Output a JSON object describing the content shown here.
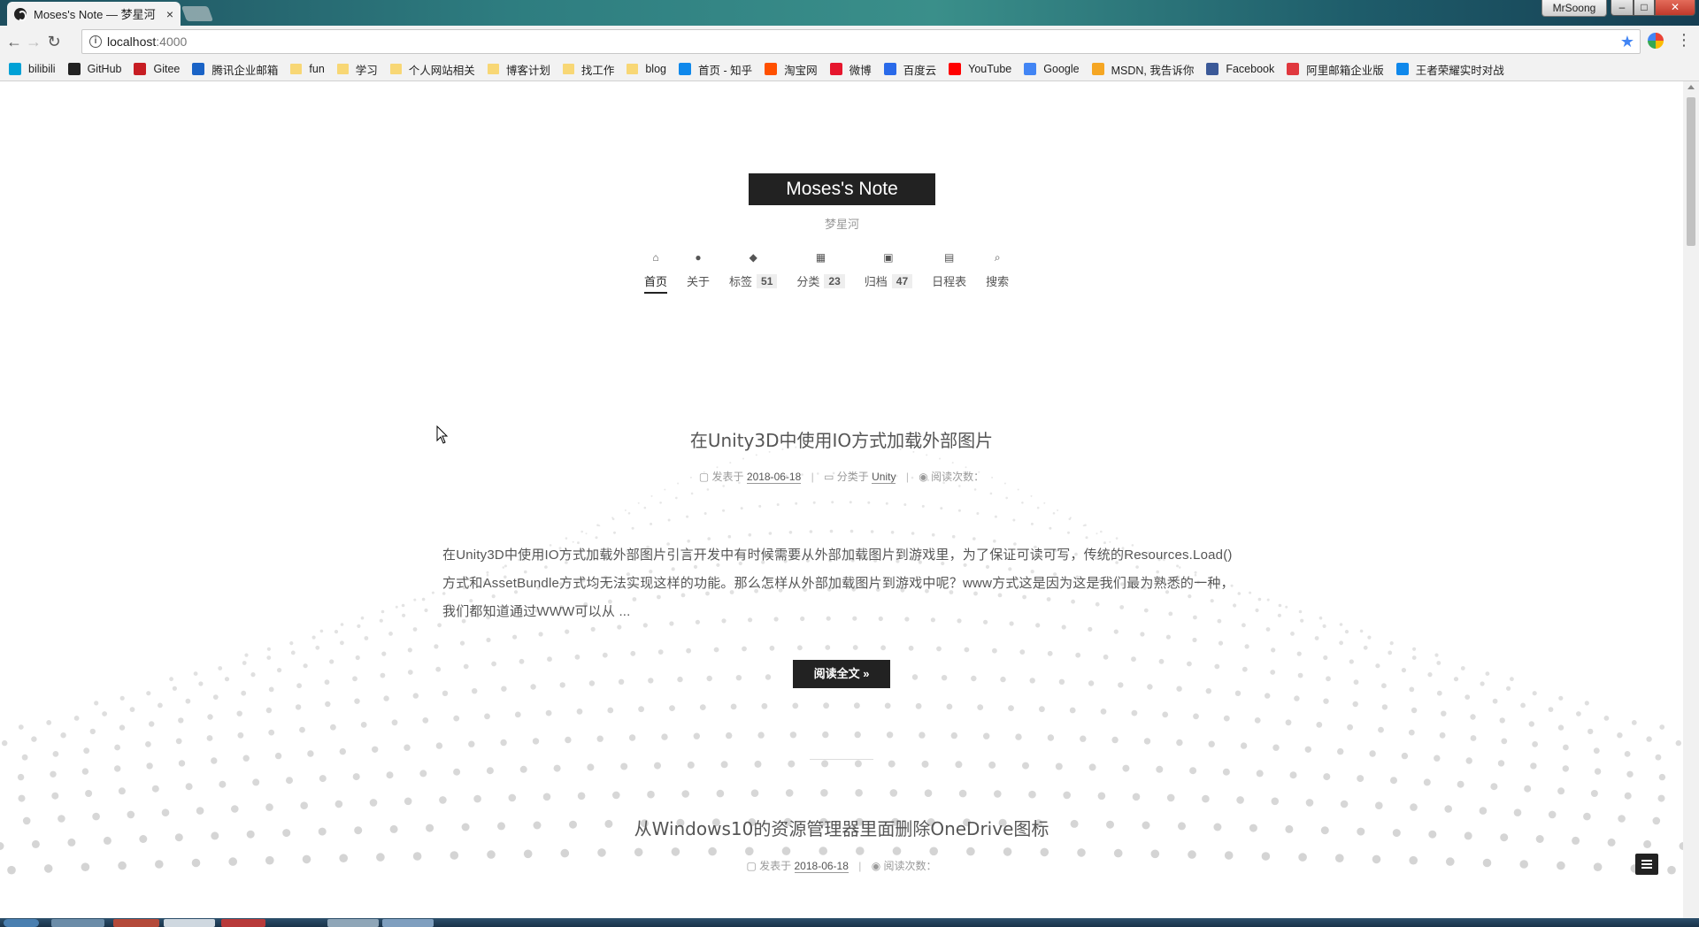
{
  "browser": {
    "tab_title": "Moses's Note — 梦星河",
    "tab_close": "×",
    "profile_name": "MrSoong",
    "window_controls": {
      "minimize": "–",
      "maximize": "□",
      "close": "✕"
    },
    "url_host": "localhost",
    "url_port": ":4000",
    "back": "←",
    "forward": "→",
    "reload": "↻",
    "star": "★",
    "menu": "⋮"
  },
  "bookmarks": [
    {
      "label": "bilibili",
      "icon": "bilibili-icon",
      "color": "#00a1d6"
    },
    {
      "label": "GitHub",
      "icon": "github-icon",
      "color": "#222222"
    },
    {
      "label": "Gitee",
      "icon": "gitee-icon",
      "color": "#c71d23"
    },
    {
      "label": "腾讯企业邮箱",
      "icon": "tencent-mail-icon",
      "color": "#1a63c6"
    },
    {
      "label": "fun",
      "icon": "folder-icon",
      "color": "#f8d775"
    },
    {
      "label": "学习",
      "icon": "folder-icon",
      "color": "#f8d775"
    },
    {
      "label": "个人网站相关",
      "icon": "folder-icon",
      "color": "#f8d775"
    },
    {
      "label": "博客计划",
      "icon": "folder-icon",
      "color": "#f8d775"
    },
    {
      "label": "找工作",
      "icon": "folder-icon",
      "color": "#f8d775"
    },
    {
      "label": "blog",
      "icon": "folder-icon",
      "color": "#f8d775"
    },
    {
      "label": "首页 - 知乎",
      "icon": "zhihu-icon",
      "color": "#0f88eb"
    },
    {
      "label": "淘宝网",
      "icon": "taobao-icon",
      "color": "#ff5000"
    },
    {
      "label": "微博",
      "icon": "weibo-icon",
      "color": "#e6162d"
    },
    {
      "label": "百度云",
      "icon": "baidu-cloud-icon",
      "color": "#2a6ae9"
    },
    {
      "label": "YouTube",
      "icon": "youtube-icon",
      "color": "#ff0000"
    },
    {
      "label": "Google",
      "icon": "google-icon",
      "color": "#4285f4"
    },
    {
      "label": "MSDN, 我告诉你",
      "icon": "msdn-icon",
      "color": "#f5a623"
    },
    {
      "label": "Facebook",
      "icon": "facebook-icon",
      "color": "#3b5998"
    },
    {
      "label": "阿里邮箱企业版",
      "icon": "ali-mail-icon",
      "color": "#e0383e"
    },
    {
      "label": "王者荣耀实时对战",
      "icon": "zhihu-icon",
      "color": "#0f88eb"
    }
  ],
  "site": {
    "brand": "Moses's Note",
    "subtitle": "梦星河",
    "menu": [
      {
        "label": "首页",
        "icon": "home-icon",
        "glyph": "⌂",
        "count": null,
        "active": true
      },
      {
        "label": "关于",
        "icon": "user-icon",
        "glyph": "●",
        "count": null,
        "active": false
      },
      {
        "label": "标签",
        "icon": "tags-icon",
        "glyph": "◆",
        "count": "51",
        "active": false
      },
      {
        "label": "分类",
        "icon": "th-icon",
        "glyph": "▦",
        "count": "23",
        "active": false
      },
      {
        "label": "归档",
        "icon": "archive-icon",
        "glyph": "▣",
        "count": "47",
        "active": false
      },
      {
        "label": "日程表",
        "icon": "calendar-icon",
        "glyph": "▤",
        "count": null,
        "active": false
      },
      {
        "label": "搜索",
        "icon": "search-icon",
        "glyph": "⌕",
        "count": null,
        "active": false
      }
    ]
  },
  "posts": [
    {
      "title": "在Unity3D中使用IO方式加载外部图片",
      "published_label": "发表于",
      "date": "2018-06-18",
      "category_label": "分类于",
      "category": "Unity",
      "views_label": "阅读次数：",
      "excerpt": "在Unity3D中使用IO方式加载外部图片引言开发中有时候需要从外部加载图片到游戏里，为了保证可读可写，传统的Resources.Load()方式和AssetBundle方式均无法实现这样的功能。那么怎样从外部加载图片到游戏中呢？www方式这是因为这是我们最为熟悉的一种，我们都知道通过WWW可以从 ...",
      "read_more": "阅读全文 »"
    },
    {
      "title": "从Windows10的资源管理器里面删除OneDrive图标",
      "published_label": "发表于",
      "date": "2018-06-18",
      "views_label": "阅读次数："
    }
  ],
  "colors": {
    "brand_bg": "#222222",
    "text": "#555555",
    "muted": "#999999",
    "particles": "#cccccc"
  }
}
